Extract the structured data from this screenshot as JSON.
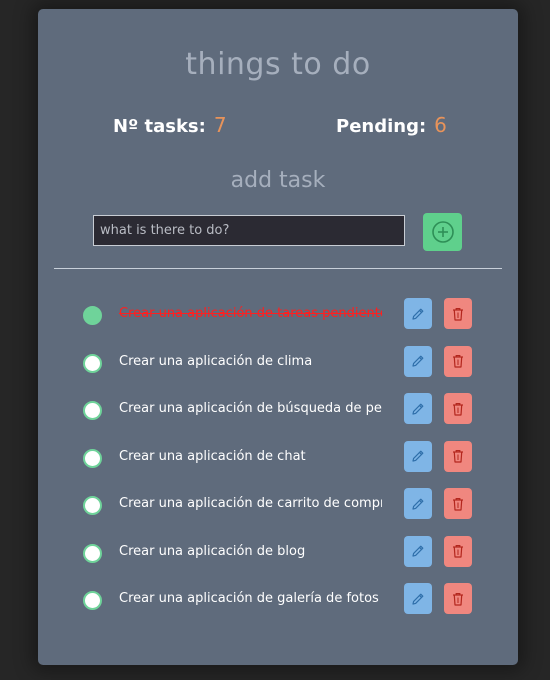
{
  "header": {
    "title": "things to do"
  },
  "stats": {
    "total_label": "Nº tasks:",
    "total_value": "7",
    "pending_label": "Pending:",
    "pending_value": "6"
  },
  "add_form": {
    "heading": "add task",
    "placeholder": "what is there to do?",
    "value": ""
  },
  "tasks": [
    {
      "text": "Crear una aplicación de tareas pendientes",
      "done": true
    },
    {
      "text": "Crear una aplicación de clima",
      "done": false
    },
    {
      "text": "Crear una aplicación de búsqueda de películas",
      "done": false
    },
    {
      "text": "Crear una aplicación de chat",
      "done": false
    },
    {
      "text": "Crear una aplicación de carrito de compras",
      "done": false
    },
    {
      "text": "Crear una aplicación de blog",
      "done": false
    },
    {
      "text": "Crear una aplicación de galería de fotos",
      "done": false
    }
  ],
  "icons": {
    "add": "plus-circle-icon",
    "edit": "pencil-icon",
    "delete": "trash-icon"
  },
  "colors": {
    "background": "#262626",
    "card": "#5f6b7c",
    "accent_number": "#e8935a",
    "add_button": "#5fd08c",
    "edit_button": "#7fb5e6",
    "delete_button": "#f0877f",
    "done_text": "#ff1f1f",
    "check_border": "#6fd39a"
  }
}
